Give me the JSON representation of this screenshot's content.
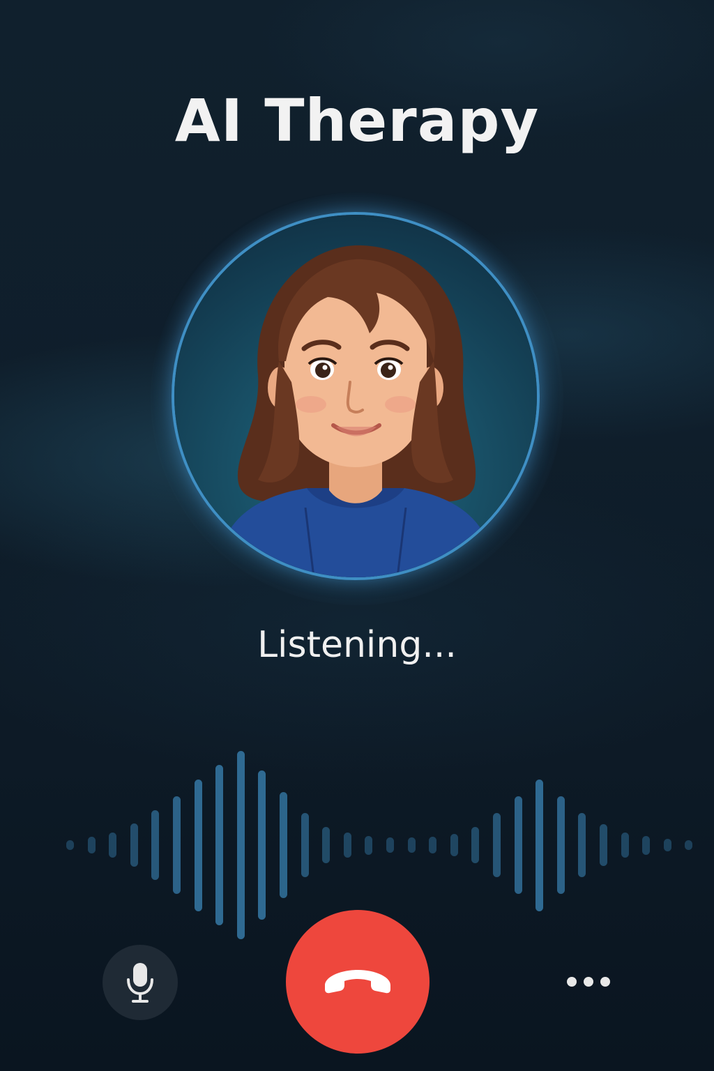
{
  "app": {
    "title": "AI Therapy",
    "status_text": "Listening..."
  },
  "avatar": {
    "description_name": "therapist-avatar"
  },
  "controls": {
    "mic_icon": "microphone-icon",
    "end_call_icon": "hang-up-icon",
    "more_icon": "more-dots-icon"
  },
  "waveform": {
    "levels": [
      0.04,
      0.09,
      0.13,
      0.23,
      0.37,
      0.52,
      0.7,
      0.85,
      1.0,
      0.79,
      0.56,
      0.34,
      0.19,
      0.13,
      0.1,
      0.08,
      0.08,
      0.09,
      0.12,
      0.19,
      0.34,
      0.52,
      0.7,
      0.52,
      0.34,
      0.22,
      0.13,
      0.1,
      0.07,
      0.04
    ]
  },
  "colors": {
    "background": "#0f1e2b",
    "accent_ring": "#3f8fc4",
    "waveform": "#2f6a92",
    "end_call": "#ee473d",
    "mic_button": "#1f2a35"
  }
}
